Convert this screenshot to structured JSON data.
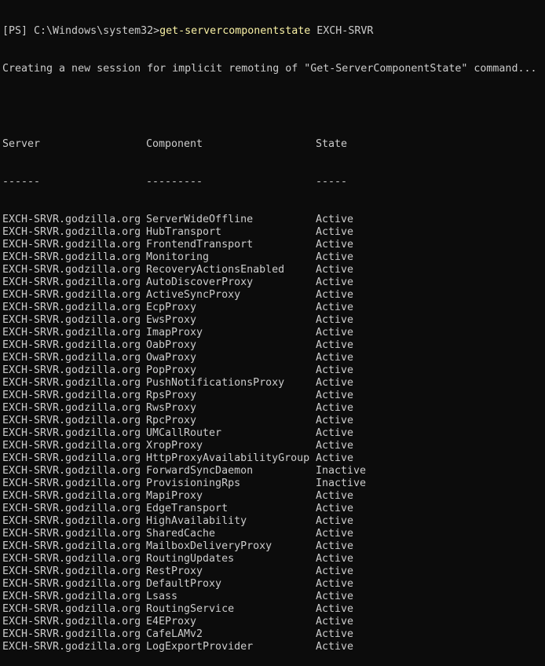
{
  "prompt": {
    "prefix": "[PS] C:\\Windows\\system32>",
    "command": "get-servercomponentstate",
    "argument": " EXCH-SRVR"
  },
  "session_message": "Creating a new session for implicit remoting of \"Get-ServerComponentState\" command...",
  "table": {
    "headers": [
      "Server",
      "Component",
      "State"
    ],
    "underlines": [
      "------",
      "---------",
      "-----"
    ],
    "rows": [
      [
        "EXCH-SRVR.godzilla.org",
        "ServerWideOffline",
        "Active"
      ],
      [
        "EXCH-SRVR.godzilla.org",
        "HubTransport",
        "Active"
      ],
      [
        "EXCH-SRVR.godzilla.org",
        "FrontendTransport",
        "Active"
      ],
      [
        "EXCH-SRVR.godzilla.org",
        "Monitoring",
        "Active"
      ],
      [
        "EXCH-SRVR.godzilla.org",
        "RecoveryActionsEnabled",
        "Active"
      ],
      [
        "EXCH-SRVR.godzilla.org",
        "AutoDiscoverProxy",
        "Active"
      ],
      [
        "EXCH-SRVR.godzilla.org",
        "ActiveSyncProxy",
        "Active"
      ],
      [
        "EXCH-SRVR.godzilla.org",
        "EcpProxy",
        "Active"
      ],
      [
        "EXCH-SRVR.godzilla.org",
        "EwsProxy",
        "Active"
      ],
      [
        "EXCH-SRVR.godzilla.org",
        "ImapProxy",
        "Active"
      ],
      [
        "EXCH-SRVR.godzilla.org",
        "OabProxy",
        "Active"
      ],
      [
        "EXCH-SRVR.godzilla.org",
        "OwaProxy",
        "Active"
      ],
      [
        "EXCH-SRVR.godzilla.org",
        "PopProxy",
        "Active"
      ],
      [
        "EXCH-SRVR.godzilla.org",
        "PushNotificationsProxy",
        "Active"
      ],
      [
        "EXCH-SRVR.godzilla.org",
        "RpsProxy",
        "Active"
      ],
      [
        "EXCH-SRVR.godzilla.org",
        "RwsProxy",
        "Active"
      ],
      [
        "EXCH-SRVR.godzilla.org",
        "RpcProxy",
        "Active"
      ],
      [
        "EXCH-SRVR.godzilla.org",
        "UMCallRouter",
        "Active"
      ],
      [
        "EXCH-SRVR.godzilla.org",
        "XropProxy",
        "Active"
      ],
      [
        "EXCH-SRVR.godzilla.org",
        "HttpProxyAvailabilityGroup",
        "Active"
      ],
      [
        "EXCH-SRVR.godzilla.org",
        "ForwardSyncDaemon",
        "Inactive"
      ],
      [
        "EXCH-SRVR.godzilla.org",
        "ProvisioningRps",
        "Inactive"
      ],
      [
        "EXCH-SRVR.godzilla.org",
        "MapiProxy",
        "Active"
      ],
      [
        "EXCH-SRVR.godzilla.org",
        "EdgeTransport",
        "Active"
      ],
      [
        "EXCH-SRVR.godzilla.org",
        "HighAvailability",
        "Active"
      ],
      [
        "EXCH-SRVR.godzilla.org",
        "SharedCache",
        "Active"
      ],
      [
        "EXCH-SRVR.godzilla.org",
        "MailboxDeliveryProxy",
        "Active"
      ],
      [
        "EXCH-SRVR.godzilla.org",
        "RoutingUpdates",
        "Active"
      ],
      [
        "EXCH-SRVR.godzilla.org",
        "RestProxy",
        "Active"
      ],
      [
        "EXCH-SRVR.godzilla.org",
        "DefaultProxy",
        "Active"
      ],
      [
        "EXCH-SRVR.godzilla.org",
        "Lsass",
        "Active"
      ],
      [
        "EXCH-SRVR.godzilla.org",
        "RoutingService",
        "Active"
      ],
      [
        "EXCH-SRVR.godzilla.org",
        "E4EProxy",
        "Active"
      ],
      [
        "EXCH-SRVR.godzilla.org",
        "CafeLAMv2",
        "Active"
      ],
      [
        "EXCH-SRVR.godzilla.org",
        "LogExportProvider",
        "Active"
      ]
    ]
  },
  "colors": {
    "background": "#0c0c0c",
    "text": "#cccccc",
    "command": "#f9f1a5"
  }
}
